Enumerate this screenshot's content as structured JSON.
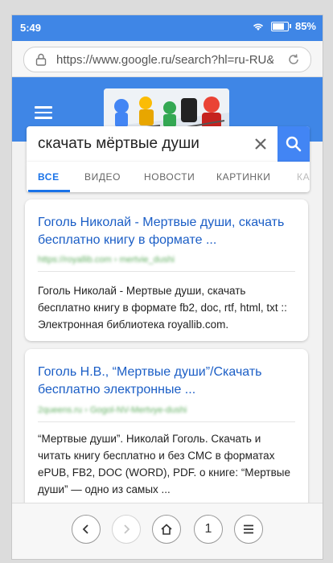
{
  "status_bar": {
    "time": "5:49",
    "battery": "85%"
  },
  "browser": {
    "url": "https://www.google.ru/search?hl=ru-RU&ie"
  },
  "search": {
    "query": "скачать мёртвые души"
  },
  "tabs": [
    {
      "label": "ВСЕ"
    },
    {
      "label": "ВИДЕО"
    },
    {
      "label": "НОВОСТИ"
    },
    {
      "label": "КАРТИНКИ"
    },
    {
      "label": "КА"
    }
  ],
  "results": [
    {
      "title": "Гоголь Николай - Мертвые души, скачать бесплатно книгу в формате ...",
      "url": "https://royallib.com › mertvie_dushi",
      "snippet": "Гоголь Николай - Мертвые души, скачать бесплатно книгу в формате fb2, doc, rtf, html, txt :: Электронная библиотека royallib.com."
    },
    {
      "title": "Гоголь Н.В., “Мертвые души”/Скачать бесплатно электронные ...",
      "url": "2queens.ru › Gogol-NV-Mertvye-dushi",
      "snippet": "“Мертвые души”. Николай Гоголь. Скачать и читать книгу бесплатно и без СМС в форматах ePUB, FB2, DOC (WORD), PDF. о книге: “Мертвые души” — одно из самых ..."
    }
  ],
  "bottom_nav": {
    "tab_count": "1"
  },
  "colors": {
    "accent": "#4285f4",
    "header": "#3f86e6",
    "link": "#1b5ec6"
  }
}
